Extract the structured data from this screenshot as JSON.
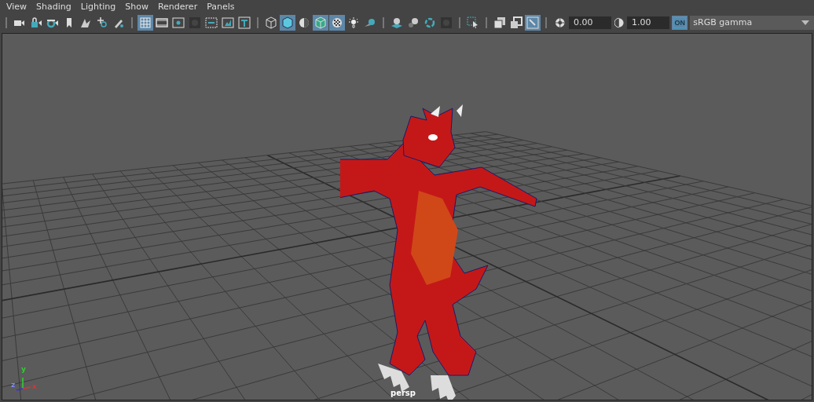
{
  "menu": [
    "View",
    "Shading",
    "Lighting",
    "Show",
    "Renderer",
    "Panels"
  ],
  "toolbar_groups": [
    [
      {
        "kind": "camera",
        "selected": false
      },
      {
        "kind": "camera-lock",
        "selected": false
      },
      {
        "kind": "camera-gear",
        "selected": false
      },
      {
        "kind": "bookmark",
        "selected": false
      },
      {
        "kind": "pan",
        "selected": false
      },
      {
        "kind": "zoom",
        "selected": false
      },
      {
        "kind": "pencil",
        "selected": false
      }
    ],
    [
      {
        "kind": "grid",
        "selected": true
      },
      {
        "kind": "film",
        "selected": false
      },
      {
        "kind": "dot",
        "selected": false
      },
      {
        "kind": "mask",
        "selected": false
      },
      {
        "kind": "field",
        "selected": false
      },
      {
        "kind": "safe",
        "selected": false
      },
      {
        "kind": "title",
        "selected": false
      }
    ],
    [
      {
        "kind": "wire-cube",
        "selected": false
      },
      {
        "kind": "cube",
        "selected": true
      },
      {
        "kind": "half",
        "selected": false
      },
      {
        "kind": "tex-cube",
        "selected": true
      },
      {
        "kind": "checker",
        "selected": true
      },
      {
        "kind": "light",
        "selected": false
      },
      {
        "kind": "shadow",
        "selected": false
      }
    ],
    [
      {
        "kind": "sphere-plane",
        "selected": false
      },
      {
        "kind": "spheres",
        "selected": false
      },
      {
        "kind": "ring",
        "selected": false
      },
      {
        "kind": "mask",
        "selected": false
      }
    ],
    [
      {
        "kind": "select",
        "selected": false
      }
    ],
    [
      {
        "kind": "isolate",
        "selected": false
      },
      {
        "kind": "xray",
        "selected": false
      },
      {
        "kind": "pen-frame",
        "selected": true
      }
    ]
  ],
  "exposure": {
    "value": "0.00"
  },
  "gamma": {
    "value": "1.00"
  },
  "color_management": {
    "label": "ON",
    "on": true
  },
  "view_transform": {
    "value": "sRGB gamma"
  },
  "axis": {
    "y": "y",
    "z": "z",
    "x": "x"
  },
  "camera_label": "persp"
}
